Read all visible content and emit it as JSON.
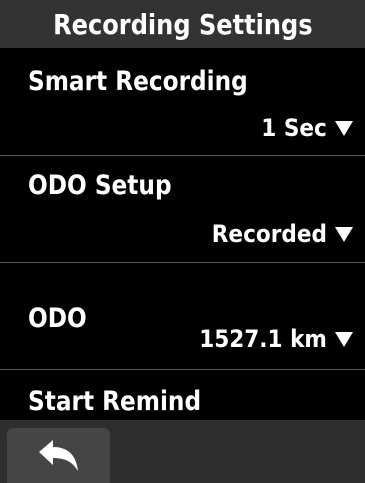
{
  "header": {
    "title": "Recording Settings"
  },
  "settings": [
    {
      "label": "Smart Recording",
      "value": "1 Sec"
    },
    {
      "label": "ODO Setup",
      "value": "Recorded"
    },
    {
      "label": "ODO",
      "value": "1527.1 km"
    },
    {
      "label": "Start Remind",
      "value": ""
    }
  ],
  "footer": {
    "back_icon": "back-arrow-icon"
  }
}
